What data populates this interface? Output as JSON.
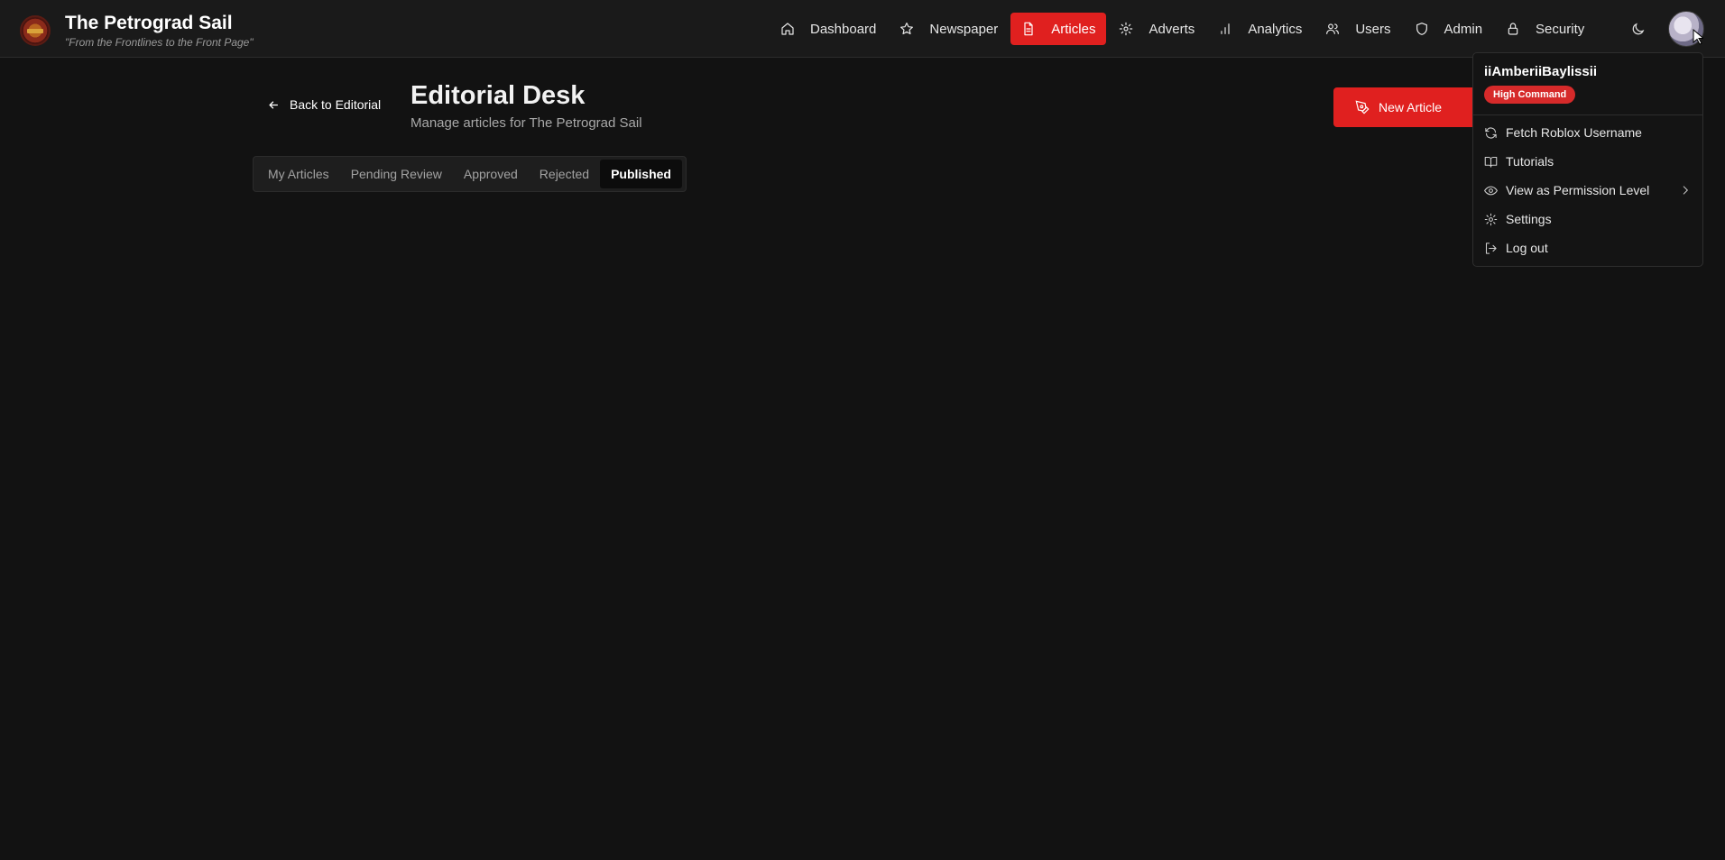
{
  "brand": {
    "title": "The Petrograd Sail",
    "tagline": "\"From the Frontlines to the Front Page\""
  },
  "nav": {
    "items": [
      {
        "label": "Dashboard",
        "icon": "home-icon"
      },
      {
        "label": "Newspaper",
        "icon": "star-icon"
      },
      {
        "label": "Articles",
        "icon": "file-text-icon"
      },
      {
        "label": "Adverts",
        "icon": "gear-icon"
      },
      {
        "label": "Analytics",
        "icon": "bar-chart-icon"
      },
      {
        "label": "Users",
        "icon": "users-icon"
      },
      {
        "label": "Admin",
        "icon": "shield-icon"
      },
      {
        "label": "Security",
        "icon": "lock-icon"
      }
    ],
    "active": "Articles"
  },
  "header": {
    "back_label": "Back to Editorial",
    "title": "Editorial Desk",
    "subtitle": "Manage articles for The Petrograd Sail",
    "new_article_label": "New Article"
  },
  "tabs": {
    "items": [
      "My Articles",
      "Pending Review",
      "Approved",
      "Rejected",
      "Published"
    ],
    "active": "Published"
  },
  "user_menu": {
    "username": "iiAmberiiBaylissii",
    "role_badge": "High Command",
    "items": [
      {
        "label": "Fetch Roblox Username",
        "icon": "refresh-icon"
      },
      {
        "label": "Tutorials",
        "icon": "book-icon"
      },
      {
        "label": "View as Permission Level",
        "icon": "eye-icon",
        "has_submenu": true
      },
      {
        "label": "Settings",
        "icon": "gear-icon"
      },
      {
        "label": "Log out",
        "icon": "logout-icon"
      }
    ]
  },
  "colors": {
    "accent": "#e0201f",
    "background": "#121212",
    "topbar": "#1a1a1a",
    "badge": "#d62a2a"
  }
}
